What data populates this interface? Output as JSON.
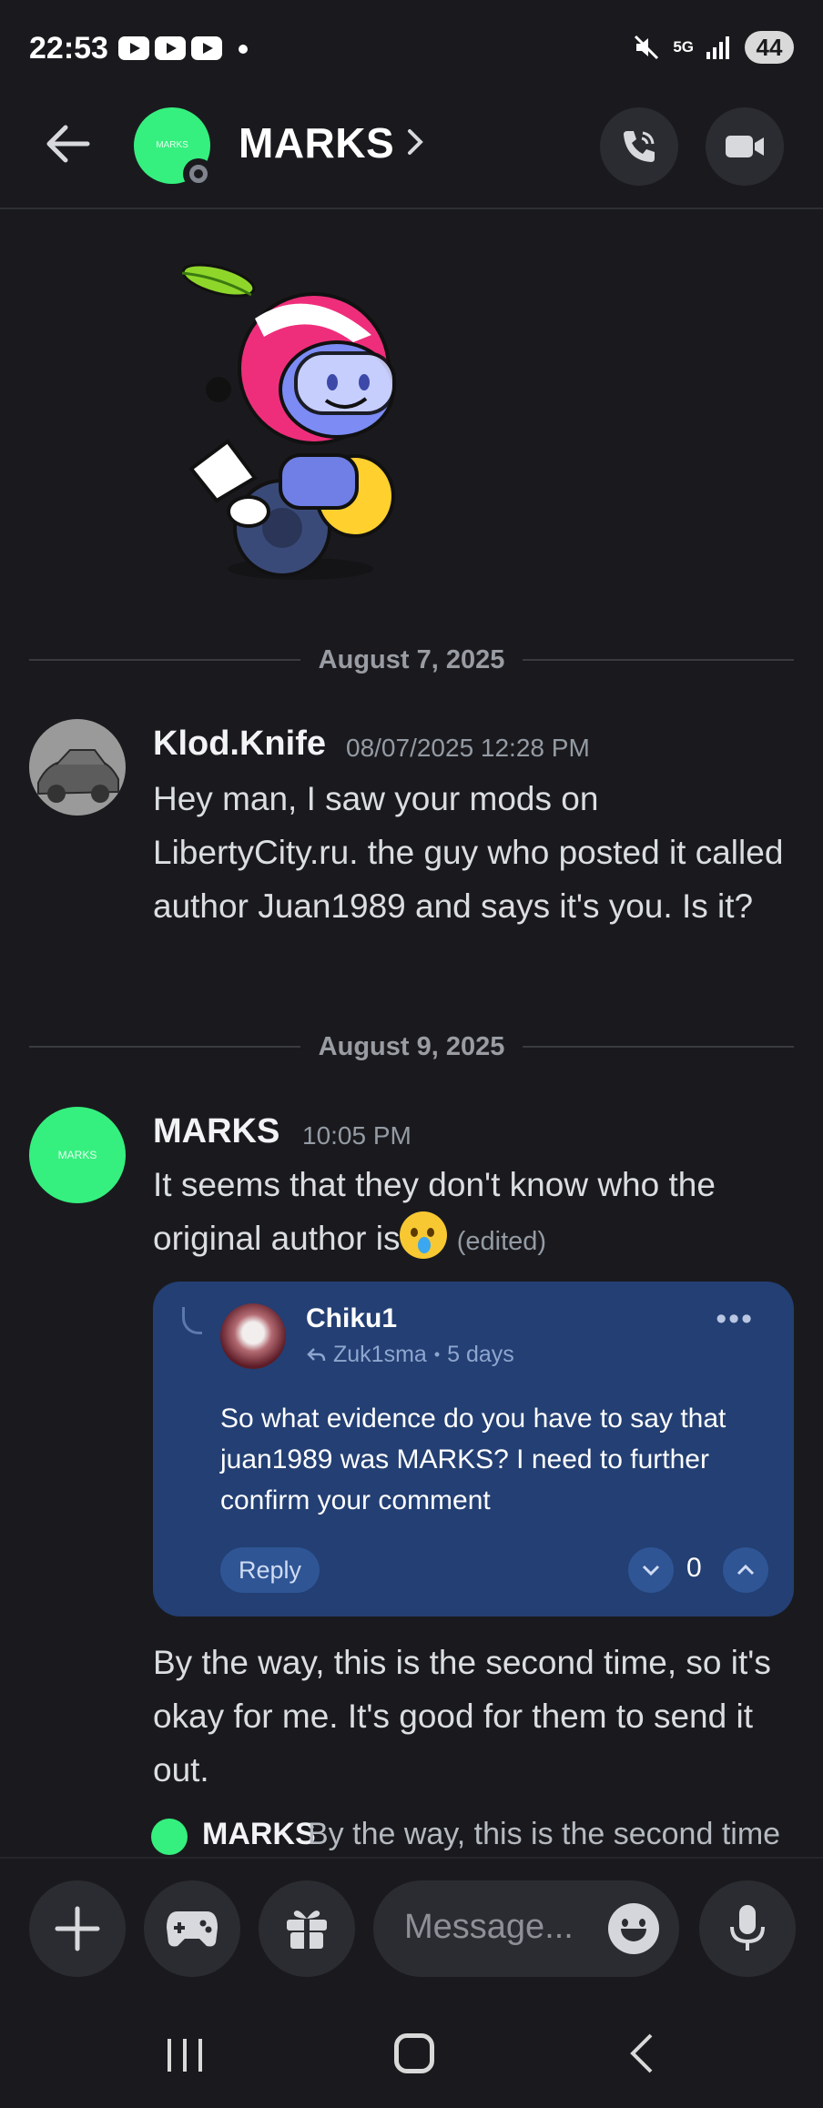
{
  "status_bar": {
    "time": "22:53",
    "network": "5G",
    "battery": "44"
  },
  "header": {
    "channel_name": "MARKS",
    "avatar_text": "MARKS"
  },
  "dividers": [
    "August 7, 2025",
    "August 9, 2025"
  ],
  "messages": [
    {
      "author": "Klod.Knife",
      "timestamp": "08/07/2025 12:28 PM",
      "text": "Hey man, I saw your mods on LibertyCity.ru. the guy who posted it called author Juan1989 and says it's you. Is it?"
    },
    {
      "author": "MARKS",
      "timestamp": "10:05 PM",
      "text": "It seems that they don't know who the original author is",
      "edited": "(edited)",
      "followup": "By the way, this is the second time, so it's okay for me. It's good for them to send it out."
    }
  ],
  "embed": {
    "author": "Chiku1",
    "reply_to": "Zuk1sma",
    "age": "5 days",
    "text": "So what evidence do you have to say that juan1989 was MARKS? I need to further confirm your comment",
    "reply_label": "Reply",
    "votes": "0"
  },
  "preview": {
    "author": "MARKS",
    "text": "By the way, this is the second time"
  },
  "composer": {
    "placeholder": "Message..."
  },
  "colors": {
    "background": "#1a1a1e",
    "brand_green": "#35f07e",
    "embed_blue": "#233f73"
  }
}
